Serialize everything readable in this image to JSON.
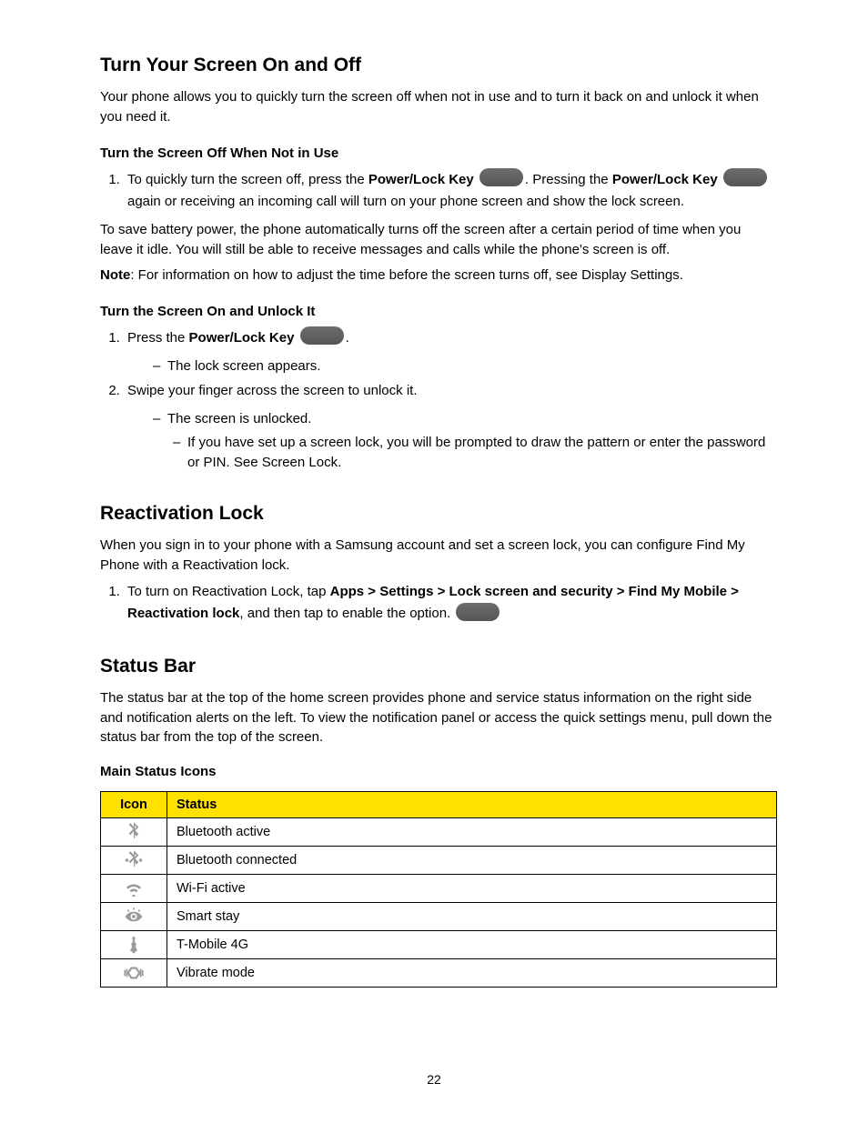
{
  "sections": {
    "sleep": {
      "heading": "Turn Your Screen On and Off",
      "intro": "Your phone allows you to quickly turn the screen off when not in use and to turn it back on and unlock it when you need it.",
      "sub1_title": "Turn the Screen Off When Not in Use",
      "sub1_step_prefix": "To quickly turn the screen off, press the ",
      "sub1_step_key": "Power/Lock Key",
      "sub1_step_rest": ". Pressing the ",
      "sub1_step_rest2": " again or receiving an incoming call will turn on your phone screen and show the lock screen.",
      "sub1_para": "To save battery power, the phone automatically turns off the screen after a certain period of time when you leave it idle. You will still be able to receive messages and calls while the phone's screen is off.",
      "sub1_note_label": "Note",
      "sub1_note": ": For information on how to adjust the time before the screen turns off, see Display Settings.",
      "sub2_title": "Turn the Screen On and Unlock It",
      "sub2_step1_prefix": "Press the ",
      "sub2_step1_key": "Power/Lock Key",
      "sub2_step1_rest": ".",
      "sub2_step1_after_label": "The lock screen appears.",
      "sub2_step2": "Swipe your finger across the screen to unlock it.",
      "sub2_step2_after": "The screen is unlocked.",
      "sub2_step2_sub": "If you have set up a screen lock, you will be prompted to draw the pattern or enter the password or PIN. See Screen Lock."
    },
    "reactivation": {
      "heading": "Reactivation Lock",
      "intro": "When you sign in to your phone with a Samsung account and set a screen lock, you can configure Find My Phone with a Reactivation lock.",
      "step_prefix": "To turn on Reactivation Lock, tap ",
      "step_path": "Apps > Settings > Lock screen and security > Find My Mobile > Reactivation lock",
      "step_rest": ", and then tap   to enable the option."
    },
    "statusbar": {
      "heading": "Status Bar",
      "intro": "The status bar at the top of the home screen provides phone and service status information on the right side and notification alerts on the left. To view the notification panel or access the quick settings menu, pull down the status bar from the top of the screen.",
      "sub_title": "Main Status Icons",
      "table_headers": {
        "icon": "Icon",
        "status": "Status"
      },
      "rows": [
        {
          "icon_name": "bluetooth-icon",
          "status": "Bluetooth active"
        },
        {
          "icon_name": "bluetooth-connected-icon",
          "status": "Bluetooth connected"
        },
        {
          "icon_name": "wifi-icon",
          "status": "Wi-Fi active"
        },
        {
          "icon_name": "smart-stay-icon",
          "status": "Smart stay"
        },
        {
          "icon_name": "tmobile-4g-icon",
          "status": "T-Mobile 4G"
        },
        {
          "icon_name": "vibrate-icon",
          "status": "Vibrate mode"
        }
      ]
    }
  },
  "page_number": "22"
}
